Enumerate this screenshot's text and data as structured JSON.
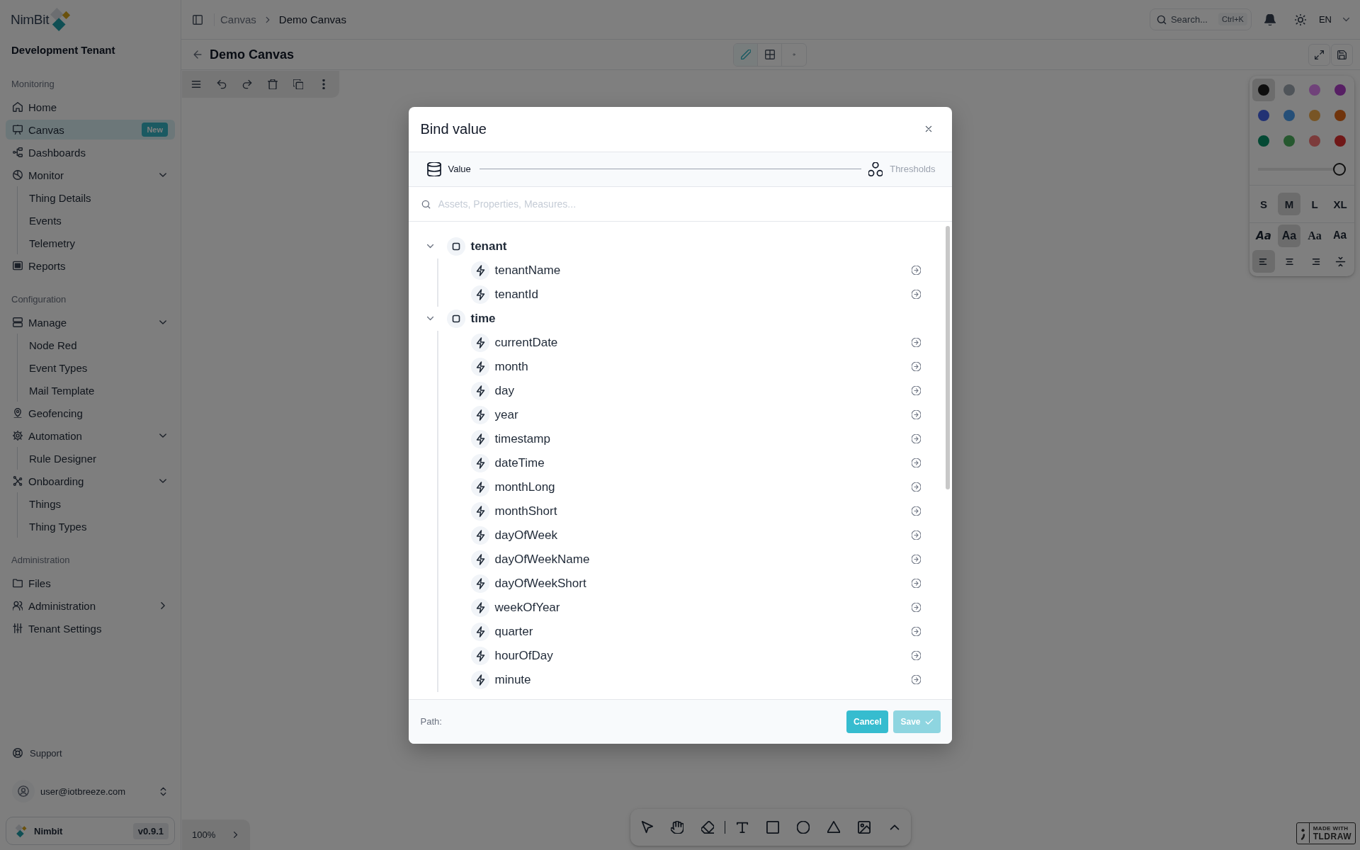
{
  "sidebar": {
    "brand": "NimBit",
    "tenant": "Development Tenant",
    "sections": [
      {
        "label": "Monitoring",
        "items": [
          {
            "kind": "link",
            "label": "Home",
            "selected": false
          },
          {
            "kind": "link",
            "label": "Canvas",
            "selected": true,
            "badge": "New"
          },
          {
            "kind": "link",
            "label": "Dashboards",
            "selected": false
          },
          {
            "kind": "group",
            "label": "Monitor",
            "selected": false,
            "expanded": true,
            "children": [
              {
                "label": "Thing Details",
                "selected": false
              },
              {
                "label": "Events",
                "selected": false
              },
              {
                "label": "Telemetry",
                "selected": false
              }
            ]
          },
          {
            "kind": "link",
            "label": "Reports",
            "selected": false
          }
        ]
      },
      {
        "label": "Configuration",
        "items": [
          {
            "kind": "group",
            "label": "Manage",
            "selected": false,
            "expanded": true,
            "children": [
              {
                "label": "Node Red",
                "selected": false
              },
              {
                "label": "Event Types",
                "selected": false
              },
              {
                "label": "Mail Template",
                "selected": false
              }
            ]
          },
          {
            "kind": "link",
            "label": "Geofencing",
            "selected": false
          },
          {
            "kind": "group",
            "label": "Automation",
            "selected": false,
            "expanded": true,
            "children": [
              {
                "label": "Rule Designer",
                "selected": false
              }
            ]
          },
          {
            "kind": "group",
            "label": "Onboarding",
            "selected": false,
            "expanded": true,
            "children": [
              {
                "label": "Things",
                "selected": false
              },
              {
                "label": "Thing Types",
                "selected": false
              }
            ]
          }
        ]
      },
      {
        "label": "Administration",
        "items": [
          {
            "kind": "link",
            "label": "Files",
            "selected": false
          },
          {
            "kind": "group",
            "label": "Administration",
            "selected": false,
            "expanded": false
          },
          {
            "kind": "link",
            "label": "Tenant Settings",
            "selected": false
          }
        ]
      }
    ],
    "support": "Support",
    "user": "user@iotbreeze.com",
    "app": {
      "name": "Nimbit",
      "version": "v0.9.1"
    }
  },
  "topbar": {
    "breadcrumb": [
      "Canvas",
      "Demo Canvas"
    ],
    "search": {
      "placeholder": "Search...",
      "shortcut": "Ctrl+K"
    },
    "language": "EN"
  },
  "canvas_header": {
    "title": "Demo Canvas",
    "modes": [
      {
        "selected": true
      },
      {
        "selected": false
      },
      {
        "selected": false
      }
    ]
  },
  "style_panel": {
    "colors": [
      {
        "color": "#0e0e0e",
        "selected": true
      },
      {
        "color": "#4f5459",
        "selected": false
      },
      {
        "color": "#70427a",
        "selected": false
      },
      {
        "color": "#571f64",
        "selected": false
      },
      {
        "color": "#223274",
        "selected": false
      },
      {
        "color": "#254f78",
        "selected": false
      },
      {
        "color": "#785525",
        "selected": false
      },
      {
        "color": "#70340c",
        "selected": false
      },
      {
        "color": "#044934",
        "selected": false
      },
      {
        "color": "#26582f",
        "selected": false
      },
      {
        "color": "#7c3b3b",
        "selected": false
      },
      {
        "color": "#701818",
        "selected": false
      }
    ],
    "opacity": {
      "level": 1
    },
    "sizes": [
      {
        "label": "S",
        "selected": false
      },
      {
        "label": "M",
        "selected": true
      },
      {
        "label": "L",
        "selected": false
      },
      {
        "label": "XL",
        "selected": false
      }
    ],
    "fonts": [
      {
        "kind": "draw",
        "label": "Aa",
        "selected": false
      },
      {
        "kind": "sans",
        "label": "Aa",
        "selected": true
      },
      {
        "kind": "serif",
        "label": "Aa",
        "selected": false
      },
      {
        "kind": "mono",
        "label": "Aa",
        "selected": false
      }
    ],
    "align": [
      {
        "selected": true
      },
      {
        "selected": false
      },
      {
        "selected": false
      },
      {
        "selected": false
      }
    ]
  },
  "zoom": "100%",
  "tldraw_badge": [
    "MADE WITH",
    "TLDRAW"
  ],
  "dialog": {
    "title": "Bind value",
    "steps": [
      {
        "label": "Value",
        "selected": true
      },
      {
        "label": "Thresholds",
        "selected": false
      }
    ],
    "search": {
      "placeholder": "Assets, Properties, Measures..."
    },
    "tree": [
      {
        "name": "tenant",
        "expanded": true,
        "children": [
          {
            "name": "tenantName",
            "selected": false
          },
          {
            "name": "tenantId",
            "selected": false
          }
        ]
      },
      {
        "name": "time",
        "expanded": true,
        "children": [
          {
            "name": "currentDate",
            "selected": false
          },
          {
            "name": "month",
            "selected": false
          },
          {
            "name": "day",
            "selected": false
          },
          {
            "name": "year",
            "selected": false
          },
          {
            "name": "timestamp",
            "selected": false
          },
          {
            "name": "dateTime",
            "selected": false
          },
          {
            "name": "monthLong",
            "selected": false
          },
          {
            "name": "monthShort",
            "selected": false
          },
          {
            "name": "dayOfWeek",
            "selected": false
          },
          {
            "name": "dayOfWeekName",
            "selected": false
          },
          {
            "name": "dayOfWeekShort",
            "selected": false
          },
          {
            "name": "weekOfYear",
            "selected": false
          },
          {
            "name": "quarter",
            "selected": false
          },
          {
            "name": "hourOfDay",
            "selected": false
          },
          {
            "name": "minute",
            "selected": false
          }
        ]
      }
    ],
    "path_label": "Path:",
    "cancel_button": {
      "label": "Cancel"
    },
    "save_button": {
      "label": "Save",
      "disabled": true
    }
  }
}
